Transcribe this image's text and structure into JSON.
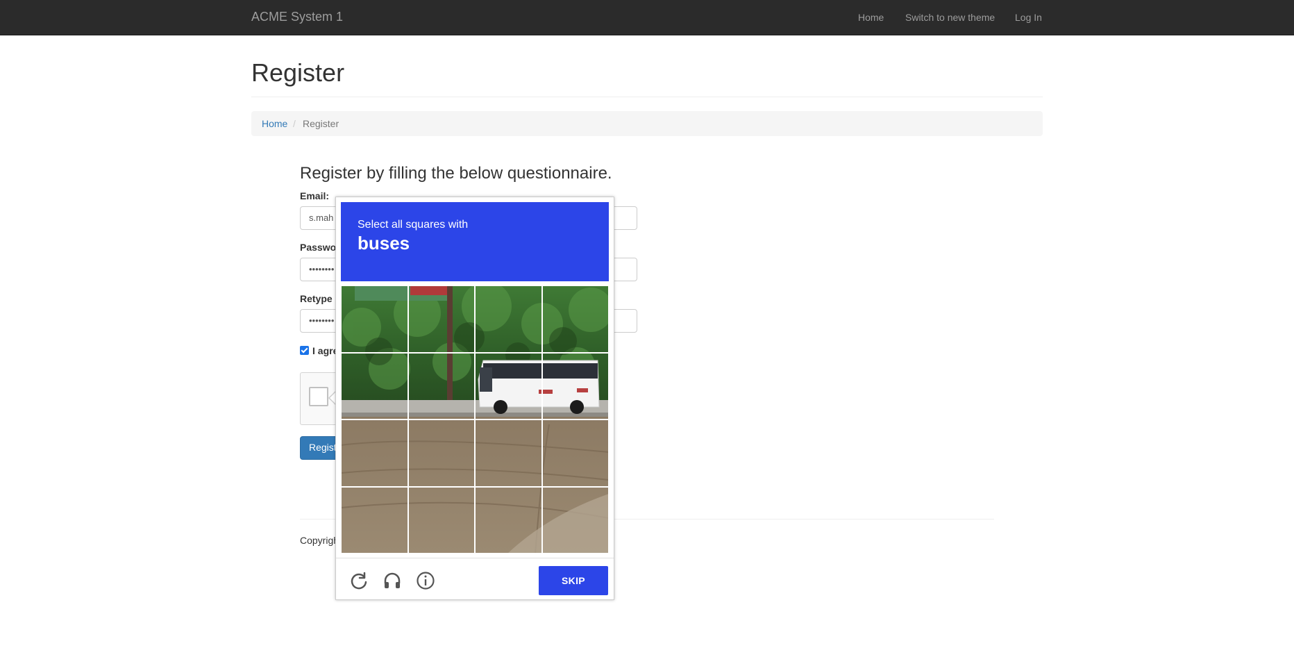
{
  "navbar": {
    "brand": "ACME System 1",
    "links": [
      "Home",
      "Switch to new theme",
      "Log In"
    ]
  },
  "page": {
    "title": "Register",
    "breadcrumb": {
      "home": "Home",
      "separator": "/",
      "current": "Register"
    }
  },
  "form": {
    "heading": "Register by filling the below questionnaire.",
    "email_label": "Email:",
    "email_value": "s.mah",
    "password_label": "Passwo",
    "password_value": "••••••••",
    "retype_label": "Retype",
    "retype_value": "••••••••",
    "agree_label": "I agre",
    "agree_checked": true,
    "register_label": "Regist"
  },
  "footer": {
    "copyright": "Copyrigh"
  },
  "captcha": {
    "instruction": "Select all squares with",
    "target": "buses",
    "skip_label": "SKIP",
    "controls": [
      "reload-icon",
      "headphones-icon",
      "info-icon"
    ],
    "accent_color": "#2c45e8",
    "tile_count": 16
  },
  "colors": {
    "navbar_bg": "#2b2b2b",
    "link": "#337ab7",
    "primary_button": "#337ab7"
  }
}
